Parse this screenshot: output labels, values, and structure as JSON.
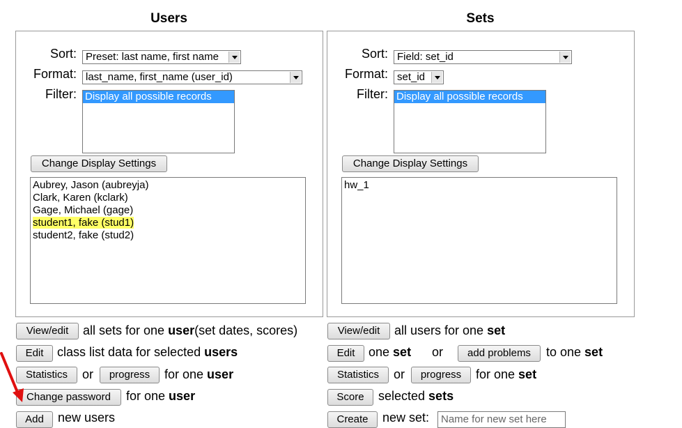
{
  "users": {
    "title": "Users",
    "sort_label": "Sort:",
    "sort_value": "Preset: last name, first name",
    "format_label": "Format:",
    "format_value": "last_name, first_name (user_id)",
    "filter_label": "Filter:",
    "filter_option": "Display all possible records",
    "change_button": "Change Display Settings",
    "list": [
      "Aubrey, Jason (aubreyja)",
      "Clark, Karen (kclark)",
      "Gage, Michael (gage)",
      "student1, fake (stud1)",
      "student2, fake (stud2)"
    ]
  },
  "sets": {
    "title": "Sets",
    "sort_label": "Sort:",
    "sort_value": "Field: set_id",
    "format_label": "Format:",
    "format_value": "set_id",
    "filter_label": "Filter:",
    "filter_option": "Display all possible records",
    "change_button": "Change Display Settings",
    "list": [
      "hw_1"
    ]
  },
  "user_actions": {
    "viewedit_btn": "View/edit",
    "viewedit_text_a": "all sets for one ",
    "viewedit_text_b": "user",
    "viewedit_text_c": "(set dates, scores)",
    "edit_btn": "Edit",
    "edit_text_a": "class list data for selected ",
    "edit_text_b": "users",
    "stats_btn": "Statistics",
    "or": "or",
    "progress_btn": "progress",
    "progress_text_a": "for one ",
    "progress_text_b": "user",
    "password_btn": "Change password",
    "password_text_a": "for one ",
    "password_text_b": "user",
    "add_btn": "Add",
    "add_text": "new users"
  },
  "set_actions": {
    "viewedit_btn": "View/edit",
    "viewedit_text_a": "all users for one ",
    "viewedit_text_b": "set",
    "edit_btn": "Edit",
    "edit_text_a": "one ",
    "edit_text_b": "set",
    "or": "or",
    "addprob_btn": "add problems",
    "addprob_text_a": "to one ",
    "addprob_text_b": "set",
    "stats_btn": "Statistics",
    "progress_btn": "progress",
    "progress_text_a": "for one ",
    "progress_text_b": "set",
    "score_btn": "Score",
    "score_text_a": "selected ",
    "score_text_b": "sets",
    "create_btn": "Create",
    "create_text": "new set:",
    "newset_placeholder": "Name for new set here"
  },
  "colors": {
    "selection": "#3399ff",
    "highlight": "#ffff66",
    "annotation_arrow": "#e01010"
  }
}
